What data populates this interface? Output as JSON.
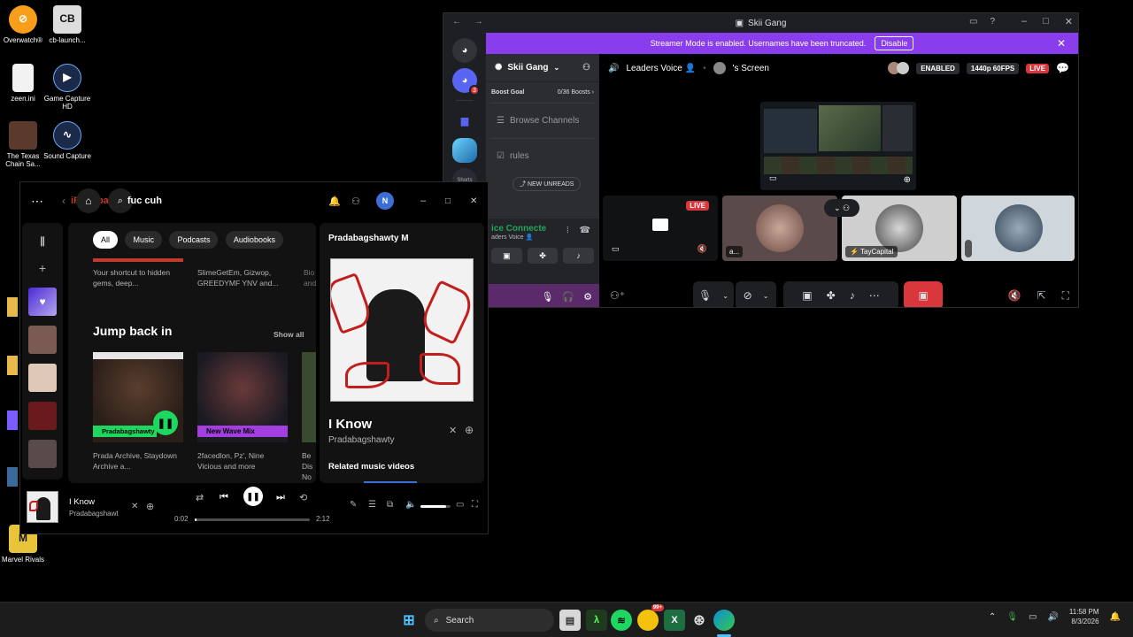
{
  "desktop": {
    "icons": [
      {
        "label": "Overwatch®"
      },
      {
        "label": "cb-launch..."
      },
      {
        "label": "zeen.ini"
      },
      {
        "label": "Game Capture HD"
      },
      {
        "label": "The Texas Chain Sa..."
      },
      {
        "label": "Sound Capture"
      },
      {
        "label": "Marvel Rivals"
      }
    ]
  },
  "discord": {
    "title": "Skii Gang",
    "streamer_banner": "Streamer Mode is enabled. Usernames have been truncated.",
    "disable_label": "Disable",
    "rail_badge": "3",
    "server_name": "Skii Gang",
    "boost_goal": "Boost Goal",
    "boost_count": "0/36 Boosts",
    "browse_channels": "Browse Channels",
    "rules": "rules",
    "new_unreads": "NEW UNREADS",
    "voice_connected": "ice Connecte",
    "voice_sub": "aders Voice 👤",
    "call_channel": "Leaders Voice 👤",
    "screen_label": "'s Screen",
    "enabled_label": "ENABLED",
    "quality_label": "1440p 60FPS",
    "live_label": "LIVE",
    "tile_live": "LIVE",
    "tile_user_a": "a...",
    "tile_user_b": "TayCapital"
  },
  "spotify": {
    "search_text": "iRagebai",
    "search_text2": "fuc cuh",
    "avatar_initial": "N",
    "chips": [
      "All",
      "Music",
      "Podcasts",
      "Audiobooks"
    ],
    "row1": [
      {
        "title": "Your shortcut to hidden gems, deep..."
      },
      {
        "title": "SlimeGetEm, Gizwop, GREEDYMF YNV and..."
      },
      {
        "title": "Bio and..."
      }
    ],
    "jump_back_in": "Jump back in",
    "show_all": "Show all",
    "cards": [
      {
        "banner": "Pradabagshawty",
        "desc": "Prada Archive, Staydown Archive a..."
      },
      {
        "banner": "New Wave Mix",
        "desc": "2facedlon, Pz', Nine Vicious and more"
      },
      {
        "banner": "",
        "desc": "Be Dis No"
      }
    ],
    "now_playing_header": "Pradabagshawty M",
    "track_title": "I Know",
    "track_artist": "Pradabagshawty",
    "related_videos": "Related music videos",
    "player_title": "I Know",
    "player_artist": "Pradabagshawt",
    "time_elapsed": "0:02",
    "time_total": "2:12",
    "progress_fraction": 0.015,
    "volume_fraction": 0.85
  },
  "taskbar": {
    "search_placeholder": "Search",
    "badge": "99+",
    "time": "11:58 PM",
    "date": "8/3/2026"
  },
  "colors": {
    "discord_purple": "#8a3ded",
    "spotify_green": "#1ed760",
    "live_red": "#da373c"
  }
}
